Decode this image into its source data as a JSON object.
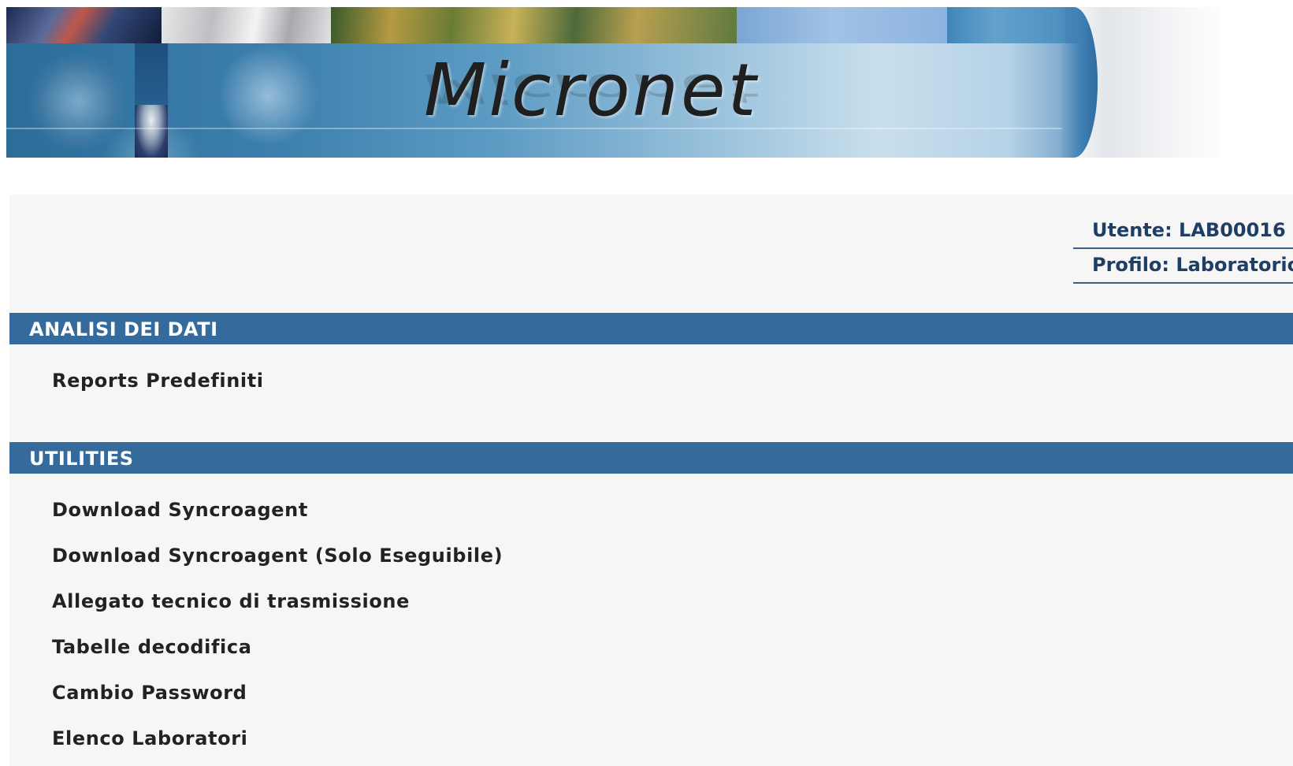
{
  "banner": {
    "title": "Micronet"
  },
  "user_info": {
    "user_line": "Utente: LAB00016",
    "profile_line": "Profilo: Laboratorio"
  },
  "sections": {
    "analisi": {
      "header": "ANALISI DEI DATI",
      "items": [
        "Reports Predefiniti"
      ]
    },
    "utilities": {
      "header": "UTILITIES",
      "items": [
        "Download Syncroagent",
        "Download Syncroagent (Solo Eseguibile)",
        "Allegato tecnico di trasmissione",
        "Tabelle decodifica",
        "Cambio Password",
        "Elenco Laboratori"
      ]
    }
  },
  "colors": {
    "section_bar": "#346b9c",
    "panel_bg": "#f7f6f7",
    "user_text": "#1e3e66",
    "menu_text": "#222222"
  }
}
